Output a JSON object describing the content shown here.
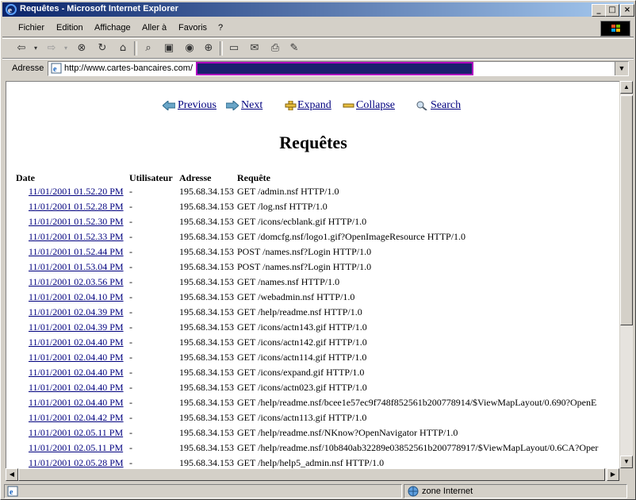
{
  "window": {
    "title": "Requêtes - Microsoft Internet Explorer",
    "min": "_",
    "max": "□",
    "close": "×"
  },
  "menu": [
    "Fichier",
    "Edition",
    "Affichage",
    "Aller à",
    "Favoris",
    "?"
  ],
  "address": {
    "label": "Adresse",
    "url": "http://www.cartes-bancaires.com/"
  },
  "nav": {
    "previous": "Previous",
    "next": "Next",
    "expand": "Expand",
    "collapse": "Collapse",
    "search": "Search"
  },
  "page": {
    "heading": "Requêtes"
  },
  "table": {
    "headers": {
      "date": "Date",
      "user": "Utilisateur",
      "address": "Adresse",
      "request": "Requête"
    },
    "rows": [
      {
        "date": "11/01/2001 01.52.20 PM",
        "user": "-",
        "address": "195.68.34.153",
        "request": "GET /admin.nsf HTTP/1.0"
      },
      {
        "date": "11/01/2001 01.52.28 PM",
        "user": "-",
        "address": "195.68.34.153",
        "request": "GET /log.nsf HTTP/1.0"
      },
      {
        "date": "11/01/2001 01.52.30 PM",
        "user": "-",
        "address": "195.68.34.153",
        "request": "GET /icons/ecblank.gif HTTP/1.0"
      },
      {
        "date": "11/01/2001 01.52.33 PM",
        "user": "-",
        "address": "195.68.34.153",
        "request": "GET /domcfg.nsf/logo1.gif?OpenImageResource HTTP/1.0"
      },
      {
        "date": "11/01/2001 01.52.44 PM",
        "user": "-",
        "address": "195.68.34.153",
        "request": "POST /names.nsf?Login HTTP/1.0"
      },
      {
        "date": "11/01/2001 01.53.04 PM",
        "user": "-",
        "address": "195.68.34.153",
        "request": "POST /names.nsf?Login HTTP/1.0"
      },
      {
        "date": "11/01/2001 02.03.56 PM",
        "user": "-",
        "address": "195.68.34.153",
        "request": "GET /names.nsf HTTP/1.0"
      },
      {
        "date": "11/01/2001 02.04.10 PM",
        "user": "-",
        "address": "195.68.34.153",
        "request": "GET /webadmin.nsf HTTP/1.0"
      },
      {
        "date": "11/01/2001 02.04.39 PM",
        "user": "-",
        "address": "195.68.34.153",
        "request": "GET /help/readme.nsf HTTP/1.0"
      },
      {
        "date": "11/01/2001 02.04.39 PM",
        "user": "-",
        "address": "195.68.34.153",
        "request": "GET /icons/actn143.gif HTTP/1.0"
      },
      {
        "date": "11/01/2001 02.04.40 PM",
        "user": "-",
        "address": "195.68.34.153",
        "request": "GET /icons/actn142.gif HTTP/1.0"
      },
      {
        "date": "11/01/2001 02.04.40 PM",
        "user": "-",
        "address": "195.68.34.153",
        "request": "GET /icons/actn114.gif HTTP/1.0"
      },
      {
        "date": "11/01/2001 02.04.40 PM",
        "user": "-",
        "address": "195.68.34.153",
        "request": "GET /icons/expand.gif HTTP/1.0"
      },
      {
        "date": "11/01/2001 02.04.40 PM",
        "user": "-",
        "address": "195.68.34.153",
        "request": "GET /icons/actn023.gif HTTP/1.0"
      },
      {
        "date": "11/01/2001 02.04.40 PM",
        "user": "-",
        "address": "195.68.34.153",
        "request": "GET /help/readme.nsf/bcee1e57ec9f748f852561b200778914/$ViewMapLayout/0.690?OpenE"
      },
      {
        "date": "11/01/2001 02.04.42 PM",
        "user": "-",
        "address": "195.68.34.153",
        "request": "GET /icons/actn113.gif HTTP/1.0"
      },
      {
        "date": "11/01/2001 02.05.11 PM",
        "user": "-",
        "address": "195.68.34.153",
        "request": "GET /help/readme.nsf/NKnow?OpenNavigator HTTP/1.0"
      },
      {
        "date": "11/01/2001 02.05.11 PM",
        "user": "-",
        "address": "195.68.34.153",
        "request": "GET /help/readme.nsf/10b840ab32289e03852561b200778917/$ViewMapLayout/0.6CA?Oper"
      },
      {
        "date": "11/01/2001 02.05.28 PM",
        "user": "-",
        "address": "195.68.34.153",
        "request": "GET /help/help5_admin.nsf HTTP/1.0"
      }
    ]
  },
  "status": {
    "zone": "zone Internet"
  },
  "colors": {
    "titlebar_start": "#0a246a",
    "titlebar_end": "#a6caf0",
    "link": "#00007f",
    "chrome": "#d4d0c8"
  }
}
